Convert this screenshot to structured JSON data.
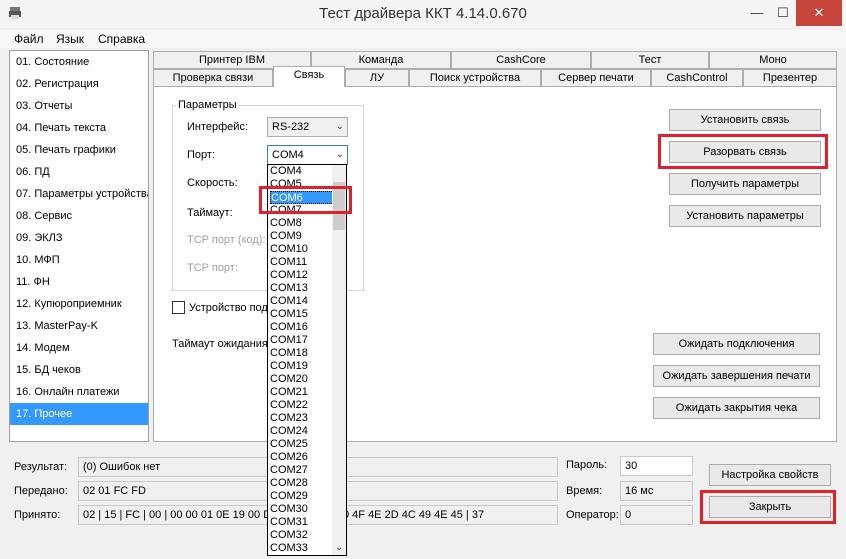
{
  "window": {
    "title": "Тест драйвера ККТ 4.14.0.670",
    "minimize": "—",
    "maximize": "☐",
    "close": "✕"
  },
  "menu": [
    "Файл",
    "Язык",
    "Справка"
  ],
  "left_list": {
    "items": [
      "01. Состояние",
      "02. Регистрация",
      "03. Отчеты",
      "04. Печать текста",
      "05. Печать графики",
      "06. ПД",
      "07. Параметры устройства",
      "08. Сервис",
      "09. ЭКЛЗ",
      "10. МФП",
      "11. ФН",
      "12. Купюроприемник",
      "13. MasterPay-K",
      "14. Модем",
      "15. БД чеков",
      "16. Онлайн платежи",
      "17. Прочее"
    ],
    "selected_index": 16
  },
  "tabs": {
    "row1": [
      "Принтер IBM",
      "Команда",
      "CashCore",
      "Тест",
      "Моно"
    ],
    "row2": [
      "Проверка связи",
      "Связь",
      "ЛУ",
      "Поиск устройства",
      "Сервер печати",
      "CashControl",
      "Презентер"
    ],
    "active": "Связь"
  },
  "params": {
    "group_title": "Параметры",
    "interface_label": "Интерфейс:",
    "interface_value": "RS-232",
    "port_label": "Порт:",
    "port_value": "COM4",
    "speed_label": "Скорость:",
    "timeout_label": "Таймаут:",
    "tcp_port_code_label": "TCP порт (код):",
    "tcp_port_label": "TCP порт:"
  },
  "device_checkbox_label": "Устройство под",
  "wait_timeout_label": "Таймаут ожидания",
  "dropdown": {
    "items": [
      "COM4",
      "COM5",
      "COM6",
      "COM7",
      "COM8",
      "COM9",
      "COM10",
      "COM11",
      "COM12",
      "COM13",
      "COM14",
      "COM15",
      "COM16",
      "COM17",
      "COM18",
      "COM19",
      "COM20",
      "COM21",
      "COM22",
      "COM23",
      "COM24",
      "COM25",
      "COM26",
      "COM27",
      "COM28",
      "COM29",
      "COM30",
      "COM31",
      "COM32",
      "COM33"
    ],
    "highlighted": "COM6",
    "scroll_down": "⌄"
  },
  "buttons": {
    "connect": "Установить связь",
    "disconnect": "Разорвать связь",
    "get_params": "Получить параметры",
    "set_params": "Установить параметры",
    "wait_connect": "Ожидать подключения",
    "wait_print": "Ожидать завершения печати",
    "wait_receipt": "Ожидать закрытия чека",
    "settings": "Настройка свойств",
    "close": "Закрыть"
  },
  "status": {
    "result_label": "Результат:",
    "result_value": "(0) Ошибок нет",
    "sent_label": "Передано:",
    "sent_value": "02 01 FC FD",
    "received_label": "Принято:",
    "received_value": "02 | 15 | FC | 00 | 00 00 01 0E 19 00 D8",
    "received_value_tail": "0 4F 4E 2D 4C 49 4E 45 | 37",
    "password_label": "Пароль:",
    "password_value": "30",
    "time_label": "Время:",
    "time_value": "16 мс",
    "operator_label": "Оператор:",
    "operator_value": "0"
  },
  "colors": {
    "selection": "#3399ff",
    "highlight_box": "#e0202a",
    "close_btn": "#c7453b"
  }
}
